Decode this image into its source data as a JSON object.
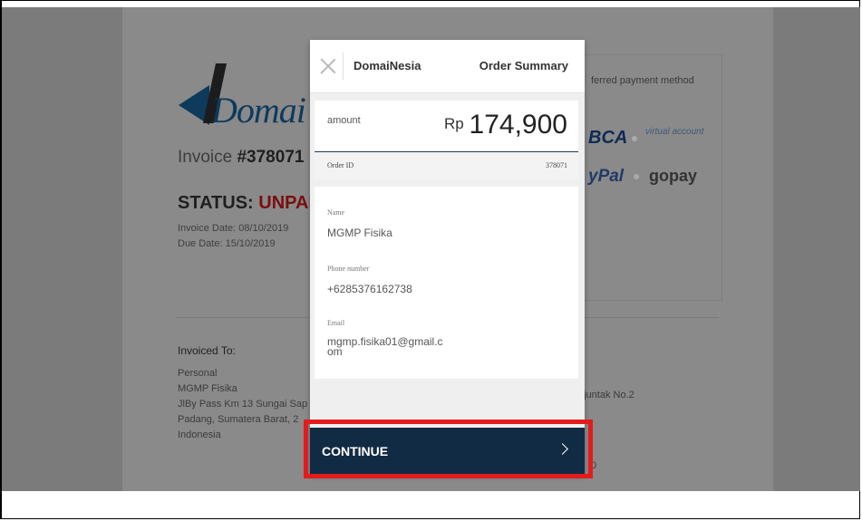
{
  "background_invoice": {
    "brand_text": "Domai",
    "invoice_label": "Invoice",
    "invoice_number": "#378071",
    "status_label": "STATUS:",
    "status_value": "UNPAI",
    "invoice_date": "Invoice Date: 08/10/2019",
    "due_date": "Due Date: 15/10/2019",
    "invoiced_to_heading": "Invoiced To:",
    "address_lines": [
      "Personal",
      "MGMP Fisika",
      "JlBy Pass Km 13 Sungai Sap",
      "Padang, Sumatera Barat, 2",
      "Indonesia"
    ],
    "payment_method_text": "ferred payment method",
    "bca_logo": "BCA",
    "virtual_account_logo": "virtual account",
    "paypal_logo": "yPal",
    "gopay_logo": "gopay",
    "address_right": "njuntak No.2",
    "stub_right": "0",
    "colors": {
      "status_unpaid": "#7a0e0e",
      "brand": "#0e3a5c"
    }
  },
  "modal": {
    "merchant_name": "DomaiNesia",
    "header_title": "Order Summary",
    "amount_label": "amount",
    "currency": "Rp",
    "amount_value": "174,900",
    "order_id_label": "Order ID",
    "order_id_value": "378071",
    "fields": {
      "name_label": "Name",
      "name_value": "MGMP Fisika",
      "phone_label": "Phone number",
      "phone_value": "+6285376162738",
      "email_label": "Email",
      "email_value": "mgmp.fisika01@gmail.com"
    },
    "continue_label": "CONTINUE",
    "colors": {
      "continue_bg": "#122b44",
      "highlight": "#e41b1b"
    }
  }
}
